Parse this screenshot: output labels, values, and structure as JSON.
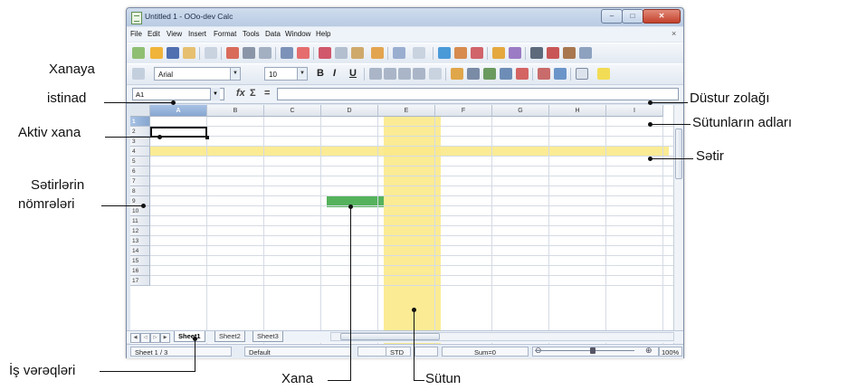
{
  "window": {
    "title": "Untitled 1 - OOo-dev Calc",
    "min_label": "–",
    "max_label": "□",
    "close_label": "✕"
  },
  "menu": [
    "File",
    "Edit",
    "View",
    "Insert",
    "Format",
    "Tools",
    "Data",
    "Window",
    "Help"
  ],
  "menu_close": "×",
  "toolbar2": {
    "font_name": "Arial",
    "font_size": "10",
    "bold": "B",
    "italic": "I",
    "underline": "U"
  },
  "formula_bar": {
    "name_box": "A1",
    "fx": "fx",
    "sum": "Σ",
    "equals": "="
  },
  "grid": {
    "columns": [
      "A",
      "B",
      "C",
      "D",
      "E",
      "F",
      "G",
      "H",
      "I"
    ],
    "rows": [
      "1",
      "2",
      "3",
      "4",
      "5",
      "6",
      "7",
      "8",
      "9",
      "10",
      "11",
      "12",
      "13",
      "14",
      "15",
      "16",
      "17"
    ]
  },
  "sheet_tabs": [
    "Sheet1",
    "Sheet2",
    "Sheet3"
  ],
  "status": {
    "sheet": "Sheet 1 / 3",
    "style": "Default",
    "mode": "STD",
    "sum": "Sum=0",
    "zoom": "100%"
  },
  "colors": {
    "highlight": "#fbe98a",
    "cell": "#55b25c"
  },
  "annotations": {
    "xanaya": "Xanaya",
    "istinad": "istinad",
    "aktiv_xana": "Aktiv xana",
    "setirlerin": "Sətirlərin",
    "nomreleri": "nömrələri",
    "is_vereqleri": "İş vərəqləri",
    "xana": "Xana",
    "sutun": "Sütun",
    "dustur": "Düstur zolağı",
    "sutunlarin": "Sütunların adları",
    "setir": "Sətir"
  }
}
